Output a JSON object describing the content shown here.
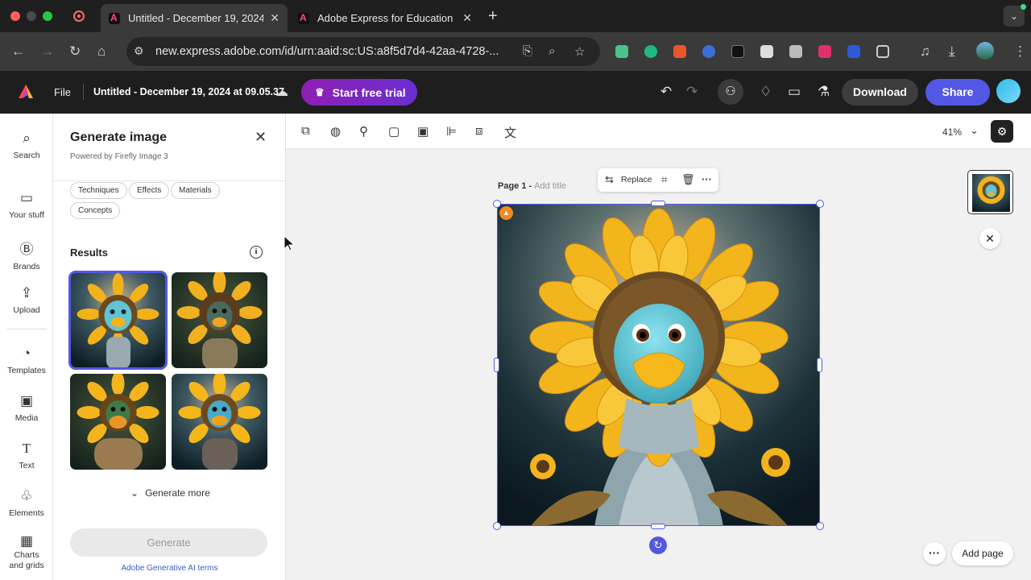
{
  "browser": {
    "tabs": [
      {
        "title": "Untitled - December 19, 2024"
      },
      {
        "title": "Adobe Express for Education"
      }
    ],
    "url": "new.express.adobe.com/id/urn:aaid:sc:US:a8f5d7d4-42aa-4728-..."
  },
  "header": {
    "file_label": "File",
    "doc_title": "Untitled - December 19, 2024 at 09.05.37",
    "trial_label": "Start free trial",
    "download_label": "Download",
    "share_label": "Share"
  },
  "rail": {
    "items": [
      {
        "label": "Search",
        "icon": "search-icon"
      },
      {
        "label": "Your stuff",
        "icon": "folder-icon"
      },
      {
        "label": "Brands",
        "icon": "brand-icon"
      },
      {
        "label": "Upload",
        "icon": "upload-icon"
      },
      {
        "label": "Templates",
        "icon": "templates-icon"
      },
      {
        "label": "Media",
        "icon": "media-icon"
      },
      {
        "label": "Text",
        "icon": "text-icon"
      },
      {
        "label": "Elements",
        "icon": "elements-icon"
      },
      {
        "label": "Charts and grids",
        "icon": "charts-icon"
      }
    ]
  },
  "panel": {
    "title": "Generate image",
    "subtitle": "Powered by Firefly Image 3",
    "chips": [
      "Techniques",
      "Effects",
      "Materials",
      "Concepts"
    ],
    "results_label": "Results",
    "generate_more_label": "Generate more",
    "generate_label": "Generate",
    "terms_label": "Adobe Generative AI terms"
  },
  "toolbar": {
    "zoom": "41%"
  },
  "canvas": {
    "page_label": "Page 1 -",
    "page_placeholder": "Add title",
    "replace_label": "Replace",
    "add_page_label": "Add page"
  },
  "colors": {
    "accent": "#5258e4",
    "trial_gradient_start": "#8e1fb3",
    "trial_gradient_end": "#6a2fd0"
  }
}
